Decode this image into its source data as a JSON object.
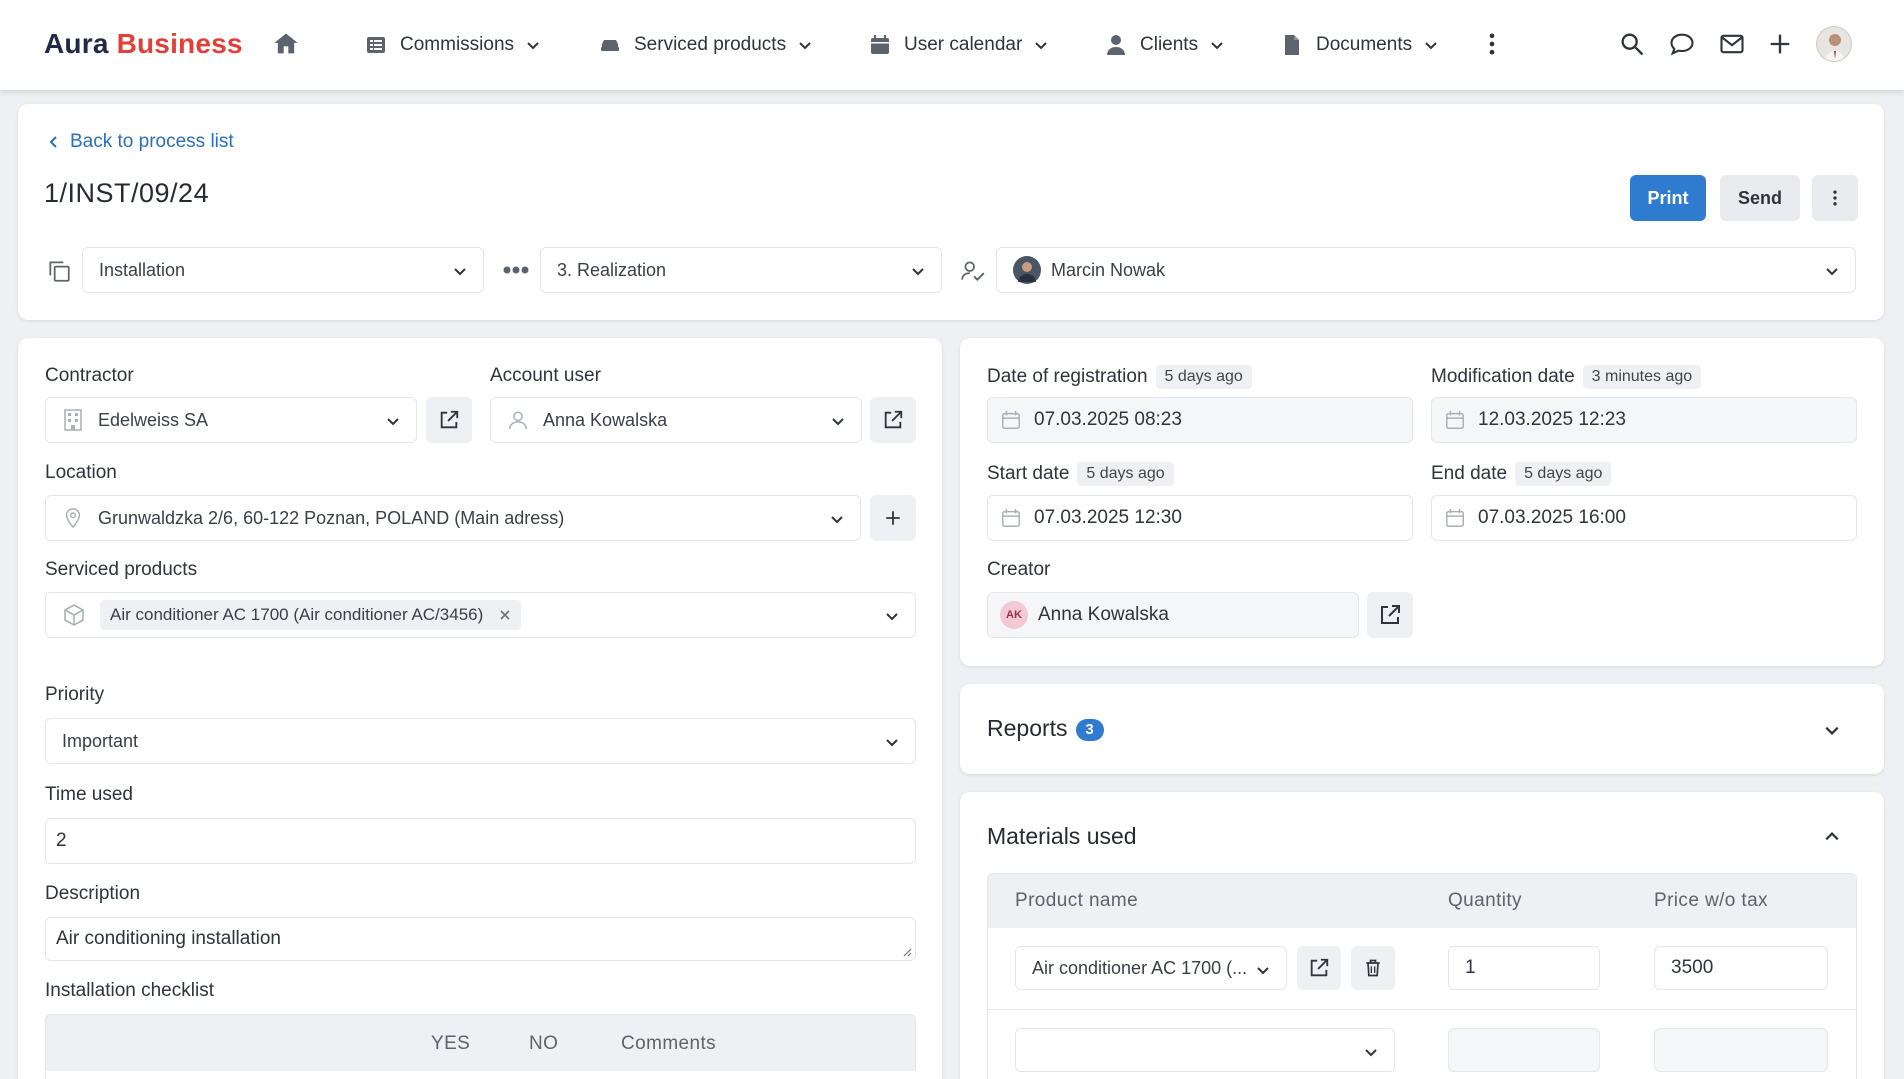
{
  "app": {
    "brand_part1": "Aura",
    "brand_part2": "Business",
    "brand_color": "#e0403a"
  },
  "nav": {
    "items": [
      {
        "label": "Commissions",
        "icon": "list-icon"
      },
      {
        "label": "Serviced products",
        "icon": "car-icon"
      },
      {
        "label": "User calendar",
        "icon": "calendar-icon"
      },
      {
        "label": "Clients",
        "icon": "person-icon"
      },
      {
        "label": "Documents",
        "icon": "document-icon"
      }
    ]
  },
  "header": {
    "back_label": "Back to process list",
    "title": "1/INST/09/24",
    "print_label": "Print",
    "send_label": "Send",
    "process_type": "Installation",
    "stage": "3. Realization",
    "assignee": "Marcin Nowak"
  },
  "form": {
    "contractor_label": "Contractor",
    "contractor_value": "Edelweiss SA",
    "account_user_label": "Account user",
    "account_user_value": "Anna Kowalska",
    "location_label": "Location",
    "location_value": "Grunwaldzka 2/6, 60-122 Poznan, POLAND (Main adress)",
    "serviced_products_label": "Serviced products",
    "serviced_product_tag": "Air conditioner AC 1700 (Air conditioner AC/3456)",
    "priority_label": "Priority",
    "priority_value": "Important",
    "time_used_label": "Time used",
    "time_used_value": "2",
    "description_label": "Description",
    "description_value": "Air conditioning installation",
    "checklist_label": "Installation checklist",
    "checklist_cols": {
      "yes": "YES",
      "no": "NO",
      "comments": "Comments"
    }
  },
  "dates": {
    "registration_label": "Date of registration",
    "registration_ago": "5 days ago",
    "registration_value": "07.03.2025 08:23",
    "modification_label": "Modification date",
    "modification_ago": "3 minutes ago",
    "modification_value": "12.03.2025 12:23",
    "start_label": "Start date",
    "start_ago": "5 days ago",
    "start_value": "07.03.2025 12:30",
    "end_label": "End date",
    "end_ago": "5 days ago",
    "end_value": "07.03.2025 16:00",
    "creator_label": "Creator",
    "creator_initials": "AK",
    "creator_value": "Anna Kowalska"
  },
  "reports": {
    "title": "Reports",
    "count": "3"
  },
  "materials": {
    "title": "Materials used",
    "columns": {
      "product": "Product name",
      "quantity": "Quantity",
      "price": "Price w/o tax"
    },
    "rows": [
      {
        "product": "Air conditioner AC 1700 (...",
        "quantity": "1",
        "price": "3500"
      },
      {
        "product": "",
        "quantity": "",
        "price": ""
      }
    ]
  },
  "colors": {
    "accent": "#2e7bcf",
    "link": "#2d6fb5"
  }
}
